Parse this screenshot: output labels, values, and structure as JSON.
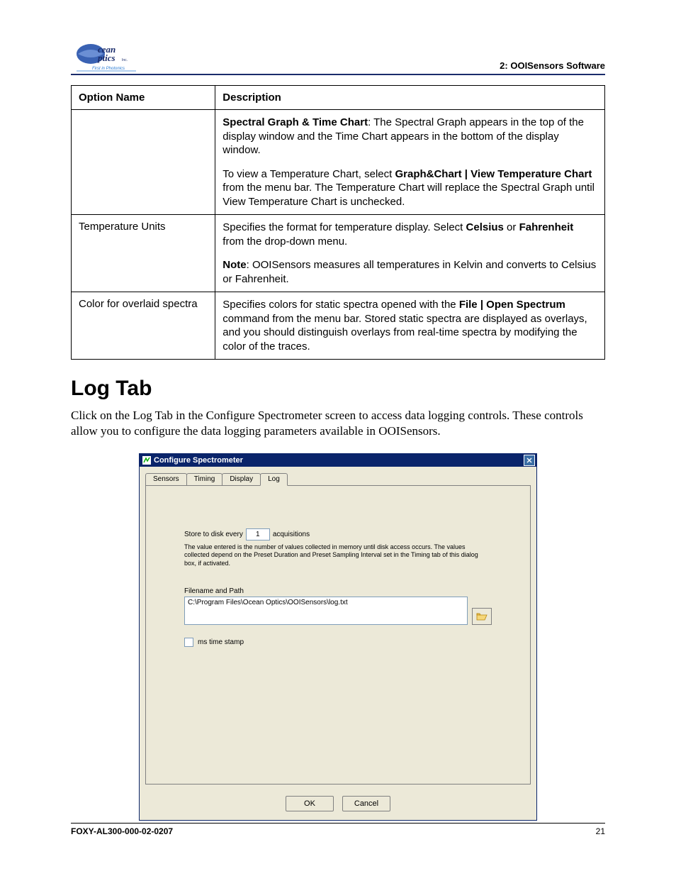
{
  "header": {
    "section_label": "2: OOISensors Software"
  },
  "table": {
    "headers": [
      "Option Name",
      "Description"
    ],
    "rows": [
      {
        "name": "",
        "desc_html": [
          {
            "frag": [
              {
                "b": true,
                "t": "Spectral Graph & Time Chart"
              },
              {
                "t": ": The Spectral Graph appears in the top of the display window and the Time Chart appears in the bottom of the display window."
              }
            ]
          },
          {
            "frag": [
              {
                "t": "To view a Temperature Chart, select "
              },
              {
                "b": true,
                "t": "Graph&Chart | View Temperature Chart"
              },
              {
                "t": " from the menu bar. The Temperature Chart will replace the Spectral Graph until View Temperature Chart is unchecked."
              }
            ]
          }
        ]
      },
      {
        "name": "Temperature Units",
        "desc_html": [
          {
            "frag": [
              {
                "t": "Specifies the format for temperature display. Select "
              },
              {
                "b": true,
                "t": "Celsius"
              },
              {
                "t": " or "
              },
              {
                "b": true,
                "t": "Fahrenheit"
              },
              {
                "t": " from the drop-down menu."
              }
            ]
          },
          {
            "frag": [
              {
                "b": true,
                "t": "Note"
              },
              {
                "t": ": OOISensors measures all temperatures in Kelvin and converts to Celsius or Fahrenheit."
              }
            ]
          }
        ]
      },
      {
        "name": "Color for overlaid spectra",
        "desc_html": [
          {
            "frag": [
              {
                "t": "Specifies colors for static spectra opened with the "
              },
              {
                "b": true,
                "t": "File | Open Spectrum"
              },
              {
                "t": " command from the menu bar. Stored static spectra are displayed as overlays, and you should distinguish overlays from real-time spectra by modifying the color of the traces."
              }
            ]
          }
        ]
      }
    ]
  },
  "heading": "Log Tab",
  "intro": "Click on the Log Tab in the Configure Spectrometer screen to access data logging controls. These controls allow you to configure the data logging parameters available in OOISensors.",
  "dialog": {
    "title": "Configure Spectrometer",
    "tabs": [
      "Sensors",
      "Timing",
      "Display",
      "Log"
    ],
    "active_tab": 3,
    "store_label_pre": "Store to disk every",
    "store_value": "1",
    "store_label_post": "acquisitions",
    "help_text": "The value entered is the number of values collected in memory until disk access occurs. The values collected depend on the Preset Duration and Preset Sampling Interval set in the Timing tab of this dialog box, if activated.",
    "filepath_label": "Filename and Path",
    "filepath_value": "C:\\Program Files\\Ocean Optics\\OOISensors\\log.txt",
    "checkbox_label": "ms time stamp",
    "ok_label": "OK",
    "cancel_label": "Cancel"
  },
  "footer": {
    "doc_id": "FOXY-AL300-000-02-0207",
    "page_num": "21"
  }
}
